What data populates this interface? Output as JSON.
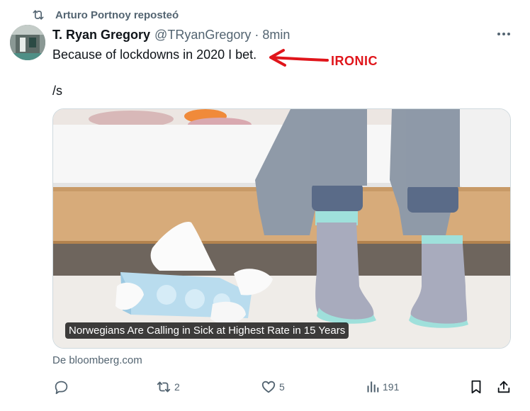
{
  "repost": {
    "icon": "repost-icon",
    "label": "Arturo Portnoy reposteó"
  },
  "tweet": {
    "author_name": "T. Ryan Gregory",
    "author_handle": "@TRyanGregory",
    "time": "· 8min",
    "text_line1": "Because of lockdowns in 2020 I bet.",
    "text_line2": "/s"
  },
  "annotation": {
    "label": "IRONIC",
    "color": "#e0151b"
  },
  "card": {
    "caption": "Norwegians Are Calling in Sick at Highest Rate in 15 Years",
    "source": "De bloomberg.com"
  },
  "actions": {
    "reply": {
      "icon": "reply-icon",
      "count": ""
    },
    "repost": {
      "icon": "repost-icon",
      "count": "2"
    },
    "like": {
      "icon": "heart-icon",
      "count": "5"
    },
    "views": {
      "icon": "views-icon",
      "count": "191"
    },
    "bookmark": {
      "icon": "bookmark-icon"
    },
    "share": {
      "icon": "share-icon"
    }
  },
  "colors": {
    "secondary_text": "#536471",
    "primary_text": "#0f1419",
    "annotation_red": "#e0151b"
  }
}
